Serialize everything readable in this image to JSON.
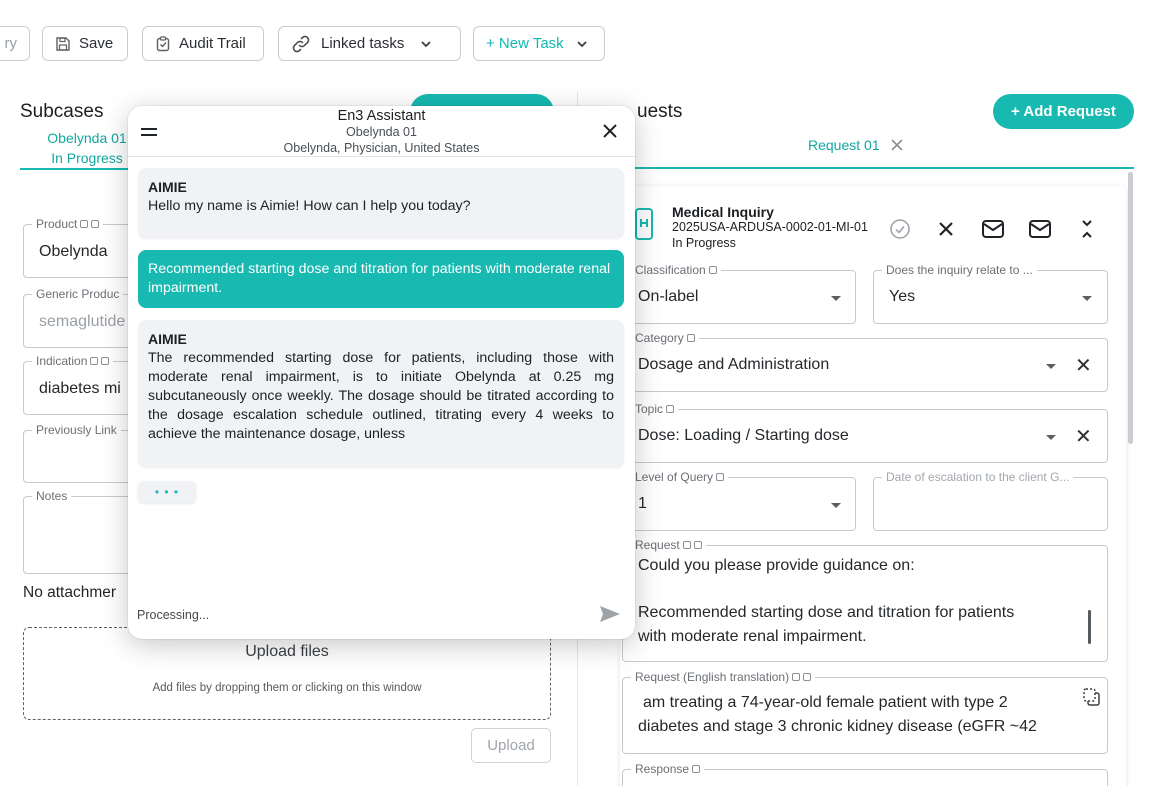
{
  "toolbar": {
    "partial_label": "ry",
    "save_label": "Save",
    "audit_label": "Audit Trail",
    "linked_label": "Linked tasks",
    "new_task_label": "+ New Task",
    "accent": "#17b9b0"
  },
  "subcases": {
    "title": "Subcases",
    "tab_line1": "Obelynda 01",
    "tab_line2": "In Progress",
    "fields": {
      "product": {
        "label": "Product",
        "value": "Obelynda"
      },
      "generic": {
        "label": "Generic Produc",
        "value": "semaglutide"
      },
      "indication": {
        "label": "Indication",
        "value": "diabetes mi"
      },
      "previously_linked": {
        "label": "Previously Link",
        "value": ""
      },
      "notes": {
        "label": "Notes",
        "value": ""
      }
    },
    "no_attachments": "No attachmer",
    "upload_title": "Upload files",
    "upload_hint": "Add files by dropping them or clicking on this window",
    "upload_button": "Upload"
  },
  "chat": {
    "title": "En3 Assistant",
    "subtitle": "Obelynda 01",
    "context": "Obelynda, Physician, United States",
    "messages": [
      {
        "sender": "AIMIE",
        "text": "Hello my name is Aimie! How can I help you today?"
      },
      {
        "sender": "",
        "text": "Recommended starting dose and titration for patients with moderate renal impairment."
      },
      {
        "sender": "AIMIE",
        "text": "The recommended starting dose for patients, including those with moderate renal impairment, is to initiate Obelynda at 0.25 mg subcutaneously once weekly. The dosage should be titrated according to the dosage escalation schedule outlined, titrating every 4 weeks to achieve the maintenance dosage, unless"
      }
    ],
    "typing": "• • •",
    "input_placeholder": "Processing..."
  },
  "requests": {
    "title_visible": "uests",
    "add_label": "+ Add Request",
    "tab_label": "Request 01",
    "card": {
      "type": "Medical Inquiry",
      "id": "2025USA-ARDUSA-0002-01-MI-01",
      "status": "In Progress"
    },
    "fields": {
      "classification": {
        "label": "Classification",
        "value": "On-label"
      },
      "relates": {
        "label": "Does the inquiry relate to ...",
        "value": "Yes"
      },
      "category": {
        "label": "Category",
        "value": "Dosage and Administration"
      },
      "topic": {
        "label": "Topic",
        "value": "Dose: Loading / Starting dose"
      },
      "level": {
        "label": "Level of Query",
        "value": "1"
      },
      "escalation": {
        "label": "Date of escalation to the client G...",
        "value": ""
      },
      "request": {
        "label": "Request",
        "line1": "Could you please provide guidance on:",
        "line2": "Recommended starting dose and titration for patients",
        "line3": "with moderate renal impairment."
      },
      "translation": {
        "label": "Request (English translation)",
        "line1": "am treating a 74-year-old female patient with type 2",
        "line2": "diabetes and stage 3 chronic kidney disease (eGFR ~42"
      },
      "response": {
        "label": "Response"
      }
    }
  }
}
